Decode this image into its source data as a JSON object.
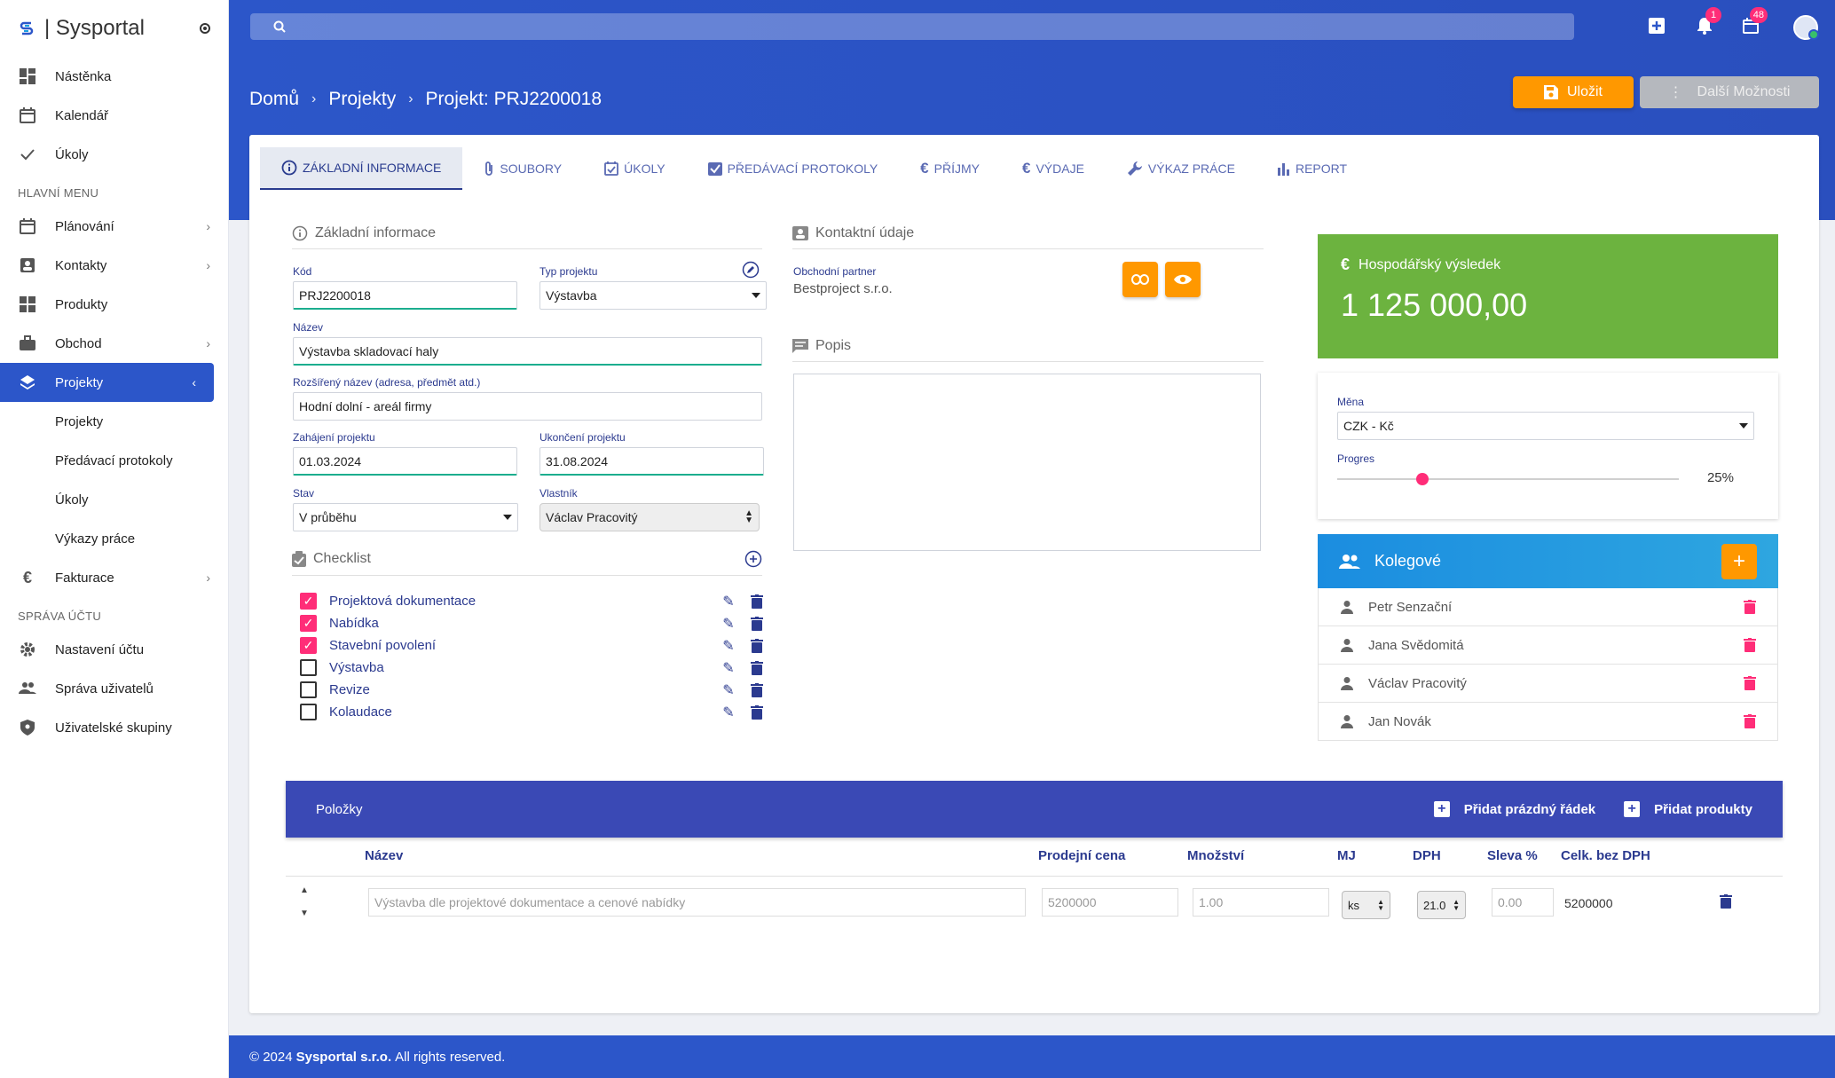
{
  "brand": {
    "name": "| Sysportal"
  },
  "sidebar": {
    "top_items": [
      {
        "label": "Nástěnka"
      },
      {
        "label": "Kalendář"
      },
      {
        "label": "Úkoly"
      }
    ],
    "main_header": "HLAVNÍ MENU",
    "main_items": [
      {
        "label": "Plánování"
      },
      {
        "label": "Kontakty"
      },
      {
        "label": "Produkty"
      },
      {
        "label": "Obchod"
      },
      {
        "label": "Projekty"
      }
    ],
    "projekty_sub": [
      {
        "label": "Projekty"
      },
      {
        "label": "Předávací protokoly"
      },
      {
        "label": "Úkoly"
      },
      {
        "label": "Výkazy práce"
      }
    ],
    "fakturace": "Fakturace",
    "account_header": "SPRÁVA ÚČTU",
    "account_items": [
      {
        "label": "Nastavení účtu"
      },
      {
        "label": "Správa uživatelů"
      },
      {
        "label": "Uživatelské skupiny"
      }
    ]
  },
  "header": {
    "notifications_badge": "1",
    "tasks_badge": "48"
  },
  "breadcrumb": [
    "Domů",
    "Projekty",
    "Projekt: PRJ2200018"
  ],
  "actions": {
    "save": "Uložit",
    "more": "Další Možnosti"
  },
  "tabs": [
    {
      "label": "ZÁKLADNÍ INFORMACE"
    },
    {
      "label": "SOUBORY"
    },
    {
      "label": "ÚKOLY"
    },
    {
      "label": "PŘEDÁVACÍ PROTOKOLY"
    },
    {
      "label": "PŘÍJMY"
    },
    {
      "label": "VÝDAJE"
    },
    {
      "label": "VÝKAZ PRÁCE"
    },
    {
      "label": "REPORT"
    }
  ],
  "basic": {
    "title": "Základní informace",
    "kod_label": "Kód",
    "kod": "PRJ2200018",
    "typ_label": "Typ projektu",
    "typ": "Výstavba",
    "nazev_label": "Název",
    "nazev": "Výstavba skladovací haly",
    "rozsireny_label": "Rozšířený název (adresa, předmět atd.)",
    "rozsireny": "Hodní dolní - areál firmy",
    "zahajeni_label": "Zahájení projektu",
    "zahajeni": "01.03.2024",
    "ukonceni_label": "Ukončení projektu",
    "ukonceni": "31.08.2024",
    "stav_label": "Stav",
    "stav": "V průběhu",
    "vlastnik_label": "Vlastník",
    "vlastnik": "Václav Pracovitý"
  },
  "checklist": {
    "title": "Checklist",
    "items": [
      {
        "label": "Projektová dokumentace",
        "checked": true
      },
      {
        "label": "Nabídka",
        "checked": true
      },
      {
        "label": "Stavební povolení",
        "checked": true
      },
      {
        "label": "Výstavba",
        "checked": false
      },
      {
        "label": "Revize",
        "checked": false
      },
      {
        "label": "Kolaudace",
        "checked": false
      }
    ]
  },
  "contact": {
    "title": "Kontaktní údaje",
    "partner_label": "Obchodní partner",
    "partner": "Bestproject s.r.o."
  },
  "popis": {
    "title": "Popis"
  },
  "result": {
    "title": "Hospodářský výsledek",
    "value": "1 125 000,00"
  },
  "meta": {
    "mena_label": "Měna",
    "mena": "CZK - Kč",
    "progres_label": "Progres",
    "progres": "25%",
    "progres_value": 0.25
  },
  "team": {
    "title": "Kolegové",
    "members": [
      "Petr Senzační",
      "Jana Svědomitá",
      "Václav Pracovitý",
      "Jan Novák"
    ]
  },
  "items": {
    "title": "Položky",
    "add_empty": "Přidat prázdný řádek",
    "add_products": "Přidat produkty",
    "columns": [
      "Název",
      "Prodejní cena",
      "Množství",
      "MJ",
      "DPH",
      "Sleva %",
      "Celk. bez DPH"
    ],
    "row": {
      "name": "Výstavba dle projektové dokumentace a cenové nabídky",
      "price": "5200000",
      "qty": "1.00",
      "unit": "ks",
      "vat": "21.0",
      "discount": "0.00",
      "total": "5200000"
    }
  },
  "footer": {
    "prefix": "© 2024",
    "company": "Sysportal s.r.o.",
    "suffix": "All rights reserved."
  },
  "colors": {
    "primary": "#2c56c9",
    "accent": "#ff9800",
    "pink": "#ff2d78",
    "green": "#6cb33f"
  }
}
